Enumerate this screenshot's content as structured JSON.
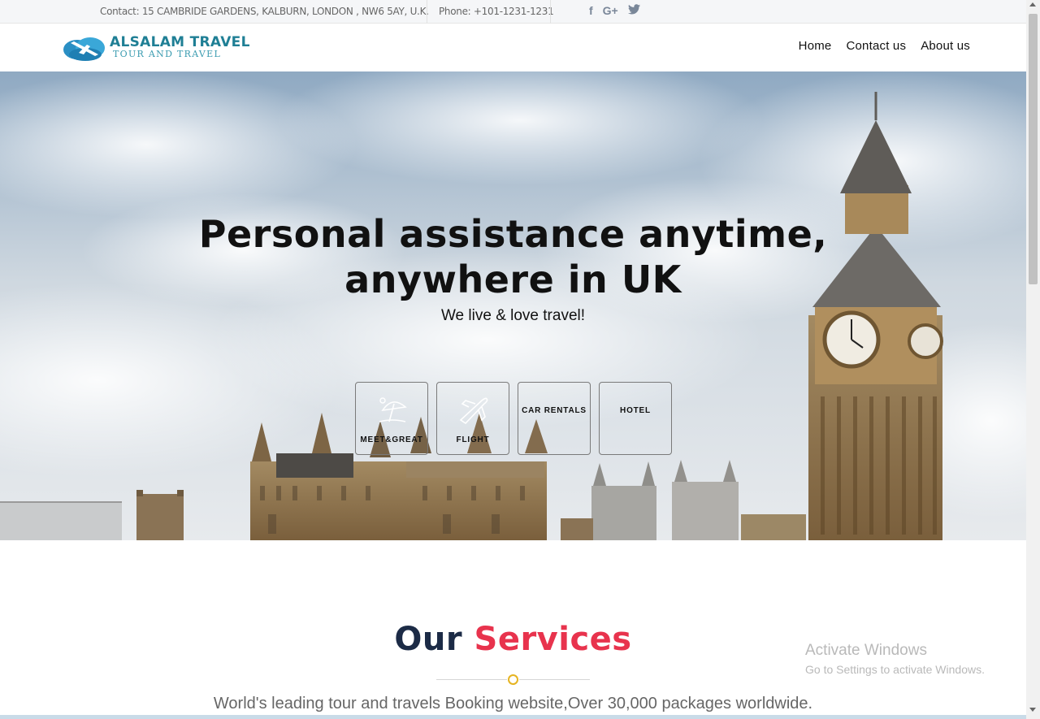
{
  "topbar": {
    "contact": "Contact: 15 CAMBRIDE GARDENS, KALBURN, LONDON , NW6 5AY, U.K.",
    "phone": "Phone: +101-1231-1231",
    "social": [
      {
        "icon": "facebook-icon",
        "glyph": "f"
      },
      {
        "icon": "google-plus-icon",
        "glyph": "G+"
      },
      {
        "icon": "twitter-icon",
        "glyph": "t"
      }
    ]
  },
  "logo": {
    "line1": "ALSALAM TRAVEL",
    "line2": "TOUR AND TRAVEL"
  },
  "nav": {
    "home": "Home",
    "contact": "Contact us",
    "about": "About us"
  },
  "hero": {
    "heading_line1": "Personal assistance anytime,",
    "heading_line2": "anywhere in UK",
    "subtitle": "We live & love travel!",
    "services": [
      {
        "label": "MEET&GREAT",
        "icon": "beach-umbrella-icon"
      },
      {
        "label": "FLIGHT",
        "icon": "airplane-icon"
      },
      {
        "label": "CAR RENTALS",
        "icon": ""
      },
      {
        "label": "HOTEL",
        "icon": ""
      }
    ]
  },
  "services_section": {
    "title_part1": "Our",
    "title_part2": "Services",
    "description": "World's leading tour and travels Booking website,Over 30,000 packages worldwide."
  },
  "watermark": {
    "line1": "Activate Windows",
    "line2": "Go to Settings to activate Windows."
  },
  "colors": {
    "accent_red": "#e8334d",
    "navy": "#1c2b46",
    "brand_teal": "#1f7f95",
    "divider_gold": "#e6b422"
  }
}
